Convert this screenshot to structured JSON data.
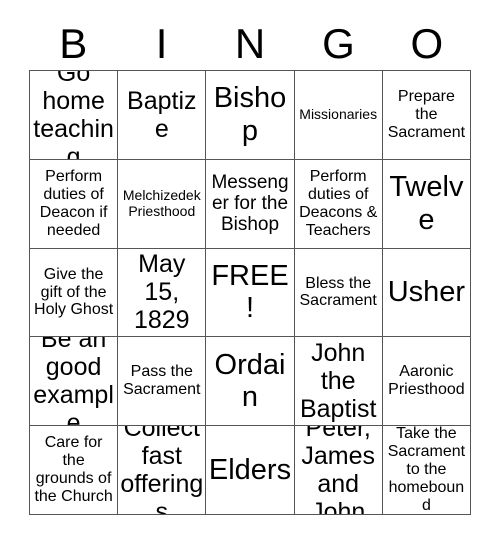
{
  "card": {
    "title_letters": [
      "B",
      "I",
      "N",
      "G",
      "O"
    ],
    "free_space_label": "FREE!",
    "border_color": "#555555",
    "text_color": "#000000",
    "background_color": "#ffffff",
    "rows": [
      [
        {
          "text": "Go home teaching",
          "size": "lg"
        },
        {
          "text": "Baptize",
          "size": "lg"
        },
        {
          "text": "Bishop",
          "size": "xl"
        },
        {
          "text": "Missionaries",
          "size": "xs"
        },
        {
          "text": "Prepare the Sacrament",
          "size": "sm"
        }
      ],
      [
        {
          "text": "Perform duties of Deacon if needed",
          "size": "sm"
        },
        {
          "text": "Melchizedek Priesthood",
          "size": "xs"
        },
        {
          "text": "Messenger for the Bishop",
          "size": "md"
        },
        {
          "text": "Perform duties of Deacons & Teachers",
          "size": "sm"
        },
        {
          "text": "Twelve",
          "size": "xl"
        }
      ],
      [
        {
          "text": "Give the gift of the Holy Ghost",
          "size": "sm"
        },
        {
          "text": "May 15, 1829",
          "size": "lg"
        },
        {
          "text": "FREE!",
          "size": "xl"
        },
        {
          "text": "Bless the Sacrament",
          "size": "sm"
        },
        {
          "text": "Usher",
          "size": "xl"
        }
      ],
      [
        {
          "text": "Be an good example",
          "size": "lg"
        },
        {
          "text": "Pass the Sacrament",
          "size": "sm"
        },
        {
          "text": "Ordain",
          "size": "xl"
        },
        {
          "text": "John the Baptist",
          "size": "lg"
        },
        {
          "text": "Aaronic Priesthood",
          "size": "sm"
        }
      ],
      [
        {
          "text": "Care for the grounds of the Church",
          "size": "sm"
        },
        {
          "text": "Collect fast offerings",
          "size": "lg"
        },
        {
          "text": "Elders",
          "size": "xl"
        },
        {
          "text": "Peter, James and John",
          "size": "lg"
        },
        {
          "text": "Take the Sacrament to the homebound",
          "size": "sm"
        }
      ]
    ]
  }
}
